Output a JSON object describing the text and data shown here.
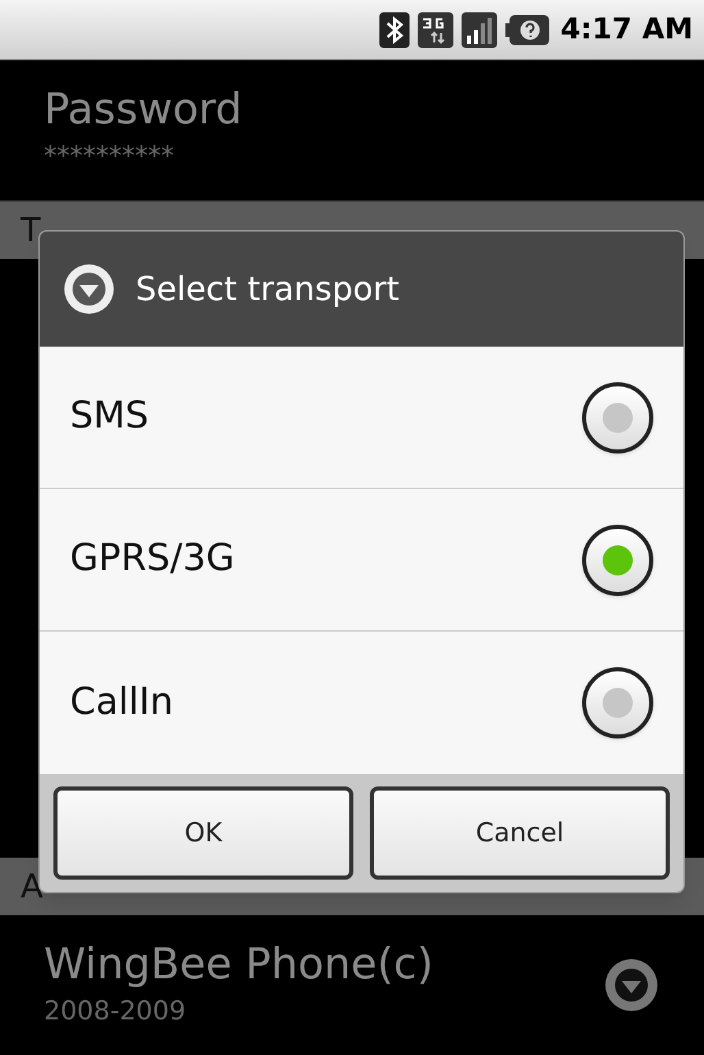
{
  "status_bar": {
    "time": "4:17 AM"
  },
  "settings": [
    {
      "kind": "item",
      "title": "Password",
      "summary": "**********"
    },
    {
      "kind": "header",
      "title": "T"
    },
    {
      "kind": "spacer"
    },
    {
      "kind": "header",
      "title": "A"
    },
    {
      "kind": "item",
      "title": "WingBee Phone(c)",
      "summary": "2008-2009",
      "dropdown": true
    }
  ],
  "dialog": {
    "title": "Select transport",
    "options": [
      {
        "label": "SMS",
        "selected": false
      },
      {
        "label": "GPRS/3G",
        "selected": true
      },
      {
        "label": "CallIn",
        "selected": false
      }
    ],
    "buttons": [
      "OK",
      "Cancel"
    ]
  }
}
